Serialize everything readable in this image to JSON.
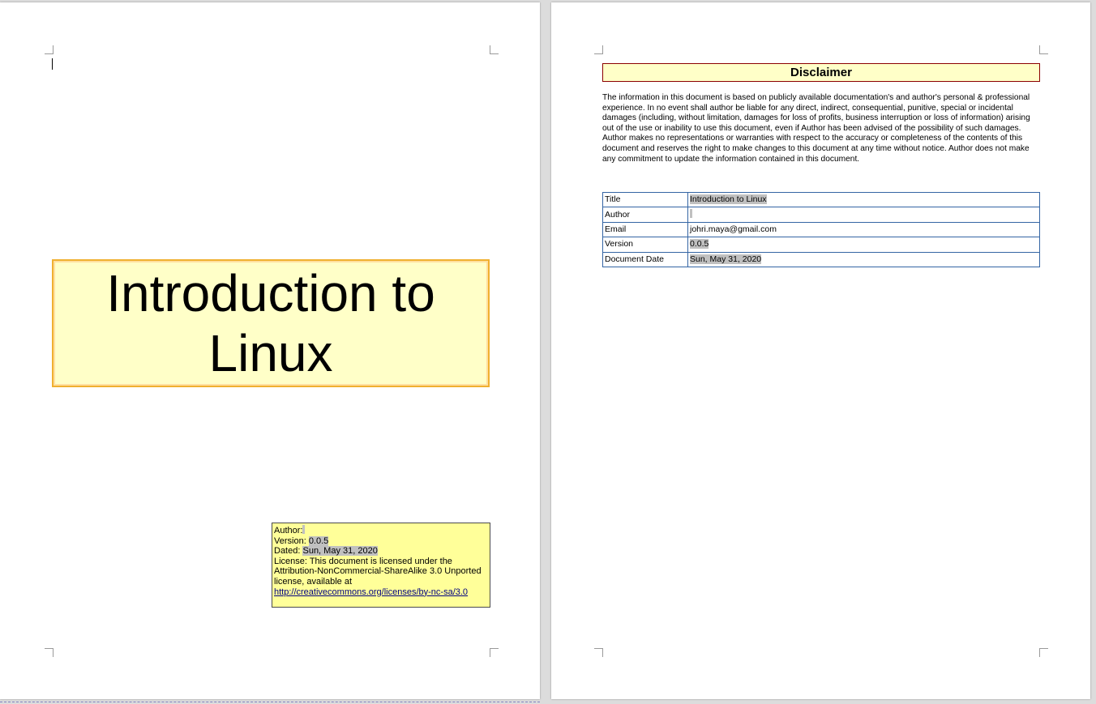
{
  "cover": {
    "title": "Introduction to Linux",
    "info": {
      "author_label": "Author:",
      "author_value": "",
      "version_label": "Version:",
      "version_value": "0.0.5",
      "dated_label": "Dated:",
      "dated_value": "Sun, May 31, 2020",
      "license_text": "License: This document is licensed under the Attribution-NonCommercial-ShareAlike 3.0 Unported license, available at",
      "license_url": "http://creativecommons.org/licenses/by-nc-sa/3.0"
    }
  },
  "disclaimer": {
    "heading": "Disclaimer",
    "body": "The information in this document is based on publicly available documentation's and author's personal & professional experience. In no event shall author be liable for any direct, indirect, consequential, punitive, special or incidental damages (including, without limitation, damages for loss of profits, business interruption or loss of information) arising out of the use or inability to use this document, even if Author has been advised of the possibility of such damages. Author makes no representations or warranties with respect to the accuracy or completeness of the contents of this document and reserves the right to make changes to this document at any time without notice. Author does not make any commitment to update the information contained in this document."
  },
  "meta_table": {
    "rows": [
      {
        "label": "Title",
        "value": "Introduction to Linux"
      },
      {
        "label": "Author",
        "value": ""
      },
      {
        "label": "Email",
        "value": "johri.maya@gmail.com"
      },
      {
        "label": "Version",
        "value": "0.0.5"
      },
      {
        "label": "Document Date",
        "value": "Sun, May 31, 2020"
      }
    ]
  },
  "colors": {
    "title_fill": "#ffffc8",
    "title_border": "#f0b030",
    "info_fill": "#ffff99",
    "field_shading": "#c0c0c0",
    "table_border": "#3465a4",
    "disclaimer_border": "#8b0000"
  }
}
